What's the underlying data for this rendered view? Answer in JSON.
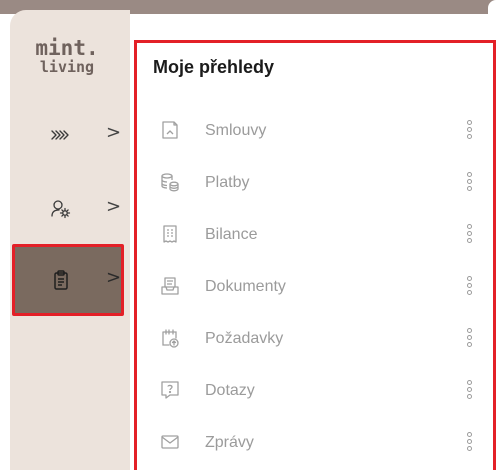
{
  "logo": {
    "line1": "mint.",
    "line2": "living"
  },
  "sidebar": {
    "items": [
      {
        "icon": "chevrons-right-icon",
        "chevron": ">"
      },
      {
        "icon": "user-settings-icon",
        "chevron": ">"
      },
      {
        "icon": "clipboard-icon",
        "chevron": ">",
        "active": true
      }
    ]
  },
  "panel": {
    "title": "Moje přehledy",
    "items": [
      {
        "icon": "contract-icon",
        "label": "Smlouvy"
      },
      {
        "icon": "coins-icon",
        "label": "Platby"
      },
      {
        "icon": "receipt-icon",
        "label": "Bilance"
      },
      {
        "icon": "inbox-document-icon",
        "label": "Dokumenty"
      },
      {
        "icon": "calendar-upload-icon",
        "label": "Požadavky"
      },
      {
        "icon": "question-box-icon",
        "label": "Dotazy"
      },
      {
        "icon": "envelope-icon",
        "label": "Zprávy"
      }
    ]
  },
  "colors": {
    "highlight": "#e32028",
    "active_bg": "#7a6a5f",
    "sidebar_bg": "#ece3dc",
    "logo": "#6f625d",
    "muted_text": "#9b9b9b"
  }
}
